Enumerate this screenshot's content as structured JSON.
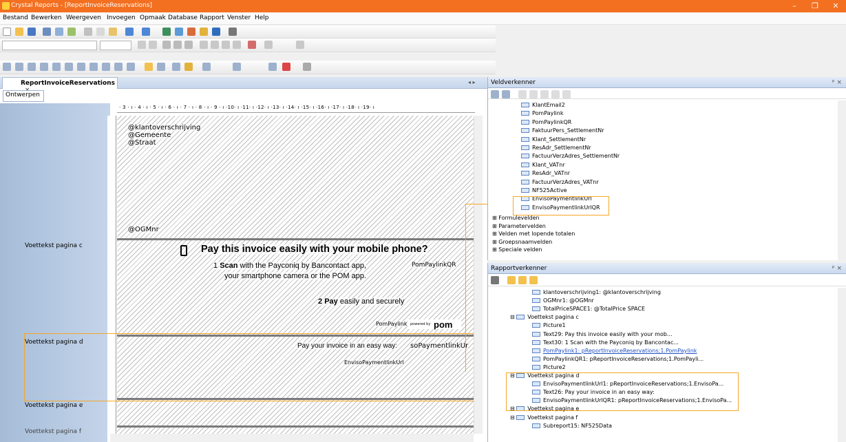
{
  "window": {
    "title": "Crystal Reports - [ReportInvoiceReservations]",
    "minimize": "–",
    "restore": "❐",
    "close": "✕"
  },
  "menu": [
    "Bestand",
    "Bewerken",
    "Weergeven",
    "Invoegen",
    "Opmaak",
    "Database",
    "Rapport",
    "Venster",
    "Help"
  ],
  "document": {
    "tab": "ReportInvoiceReservations",
    "tab_close": "×",
    "mode_tab": "Ontwerpen",
    "nav": "◂ ▸"
  },
  "ruler": {
    "top": "· 3 · ı · 4 · ı · 5 · ı · 6 · ı · 7 · ı · 8 · ı · 9 · ı ·10· ı ·11· ı ·12· ı ·13· ı ·14· ı ·15· ı ·16· ı ·17· ı ·18· ı ·19· ı"
  },
  "sections": {
    "c": "Voettekst pagina c",
    "d": "Voettekst pagina d",
    "e": "Voettekst pagina e",
    "f": "Voettekst pagina f"
  },
  "canvas": {
    "klant": "@klantoverschrijving",
    "gemeente": "@Gemeente",
    "straat": "@Straat",
    "ogmnr": "@OGMnr",
    "headline": "Pay this invoice easily with your mobile phone?",
    "step1_num": "1",
    "step1_bold": "Scan",
    "step1_rest": "with the Payconiq by Bancontact app,",
    "step1_line2": "your smartphone camera or the POM app.",
    "paylinkqr": "PomPaylinkQR",
    "step2_num": "2",
    "step2_bold": "Pay",
    "step2_rest": "easily and securely",
    "pompaylink": "PomPaylink",
    "powered": "powered by",
    "pom": "pom",
    "pay_easy": "Pay your invoice in an easy way:",
    "envqr": "soPaymentlinkUr",
    "envurl": "EnvisoPaymentlinkUrl"
  },
  "veld": {
    "title": "Veldverkenner",
    "pin": "ᵖ ×",
    "items": [
      "KlantEmail2",
      "PomPaylink",
      "PomPaylinkQR",
      "FaktuurPers_SettlementNr",
      "Klant_SettlementNr",
      "ResAdr_SettlementNr",
      "FactuurVerzAdres_SettlementNr",
      "Klant_VATnr",
      "ResAdr_VATnr",
      "FactuurVerzAdres_VATnr",
      "NF525Active",
      "EnvisoPaymentlinkUrl",
      "EnvisoPaymentlinkUrlQR"
    ],
    "groups": [
      "Formulevelden",
      "Parametervelden",
      "Velden met lopende totalen",
      "Groepsnaamvelden",
      "Speciale velden"
    ]
  },
  "rapport": {
    "title": "Rapportverkenner",
    "pin": "ᵖ ×",
    "items": [
      {
        "t": "klantoverschrijving1: @klantoverschrijving",
        "lvl": 2
      },
      {
        "t": "OGMnr1: @OGMnr",
        "lvl": 2
      },
      {
        "t": "TotalPriceSPACE1: @TotalPrice SPACE",
        "lvl": 2
      },
      {
        "t": "Voettekst pagina c",
        "lvl": 1
      },
      {
        "t": "Picture1",
        "lvl": 2
      },
      {
        "t": "Text29: Pay this invoice easily with your mob...",
        "lvl": 2
      },
      {
        "t": "Text30: 1 Scan with the Payconiq by Bancontac...",
        "lvl": 2
      },
      {
        "t": "PomPaylink1: pReportInvoiceReservations;1.PomPaylink",
        "lvl": 2
      },
      {
        "t": "PomPaylinkQR1: pReportInvoiceReservations;1.PomPayli...",
        "lvl": 2
      },
      {
        "t": "Picture2",
        "lvl": 2
      },
      {
        "t": "Voettekst pagina d",
        "lvl": 1
      },
      {
        "t": "EnvisoPaymentlinkUrl1: pReportInvoiceReservations;1.EnvisoPa...",
        "lvl": 2
      },
      {
        "t": "Text26: Pay your invoice in an easy way:",
        "lvl": 2
      },
      {
        "t": "EnvisoPaymentlinkUrlQR1: pReportInvoiceReservations;1.EnvisoPa...",
        "lvl": 2
      },
      {
        "t": "Voettekst pagina e",
        "lvl": 1
      },
      {
        "t": "Voettekst pagina f",
        "lvl": 1
      },
      {
        "t": "Subreport15: NF525Data",
        "lvl": 2
      }
    ]
  },
  "colors": {
    "accent": "#f37021",
    "highlight": "#f5a623"
  }
}
